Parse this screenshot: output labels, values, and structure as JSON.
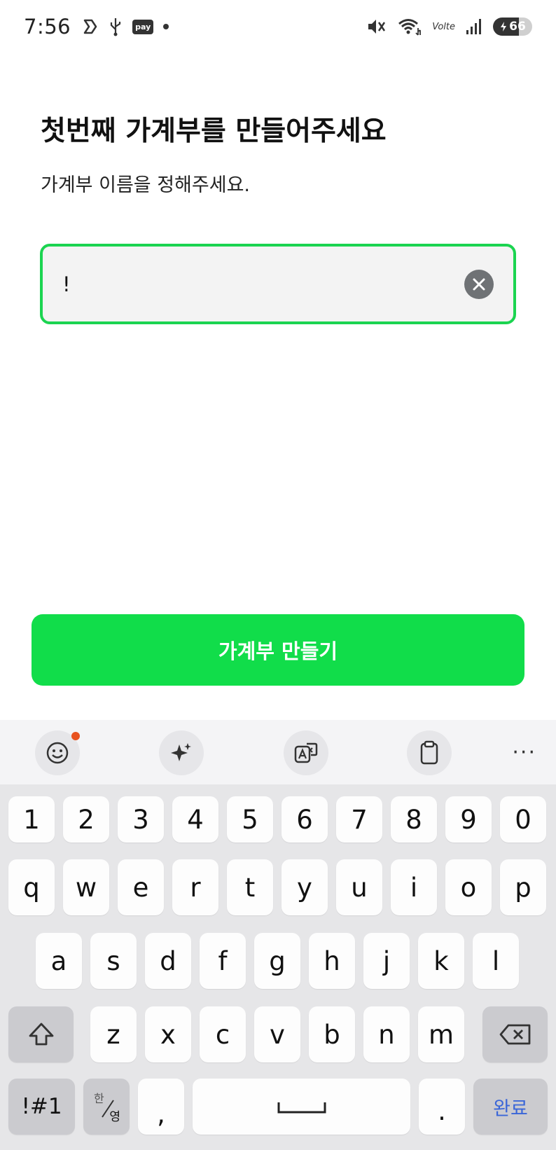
{
  "status_bar": {
    "time": "7:56",
    "pay_label": "pay",
    "lte_label": "Volte",
    "battery_level": "66",
    "icons": [
      "samsung-s-icon",
      "usb-icon",
      "pay-icon",
      "notification-dot-icon",
      "mute-icon",
      "wifi-icon",
      "lte-icon",
      "signal-icon",
      "battery-icon"
    ]
  },
  "page": {
    "title": "첫번째 가계부를 만들어주세요",
    "subtitle": "가계부 이름을 정해주세요.",
    "input_value": "!",
    "create_button": "가계부 만들기"
  },
  "colors": {
    "accent": "#11dd4a",
    "input_border": "#1bd450",
    "done_text": "#3a66d8"
  },
  "keyboard": {
    "toolbar": [
      "emoji-icon",
      "sparkle-icon",
      "translate-icon",
      "clipboard-icon",
      "more-icon"
    ],
    "more_label": "···",
    "number_row": [
      "1",
      "2",
      "3",
      "4",
      "5",
      "6",
      "7",
      "8",
      "9",
      "0"
    ],
    "row1": [
      "q",
      "w",
      "e",
      "r",
      "t",
      "y",
      "u",
      "i",
      "o",
      "p"
    ],
    "row2": [
      "a",
      "s",
      "d",
      "f",
      "g",
      "h",
      "j",
      "k",
      "l"
    ],
    "row3": [
      "z",
      "x",
      "c",
      "v",
      "b",
      "n",
      "m"
    ],
    "symbols_key": "!#1",
    "han_label": "한",
    "yeong_label": "영",
    "comma": ",",
    "period": ".",
    "done_key": "완료"
  }
}
